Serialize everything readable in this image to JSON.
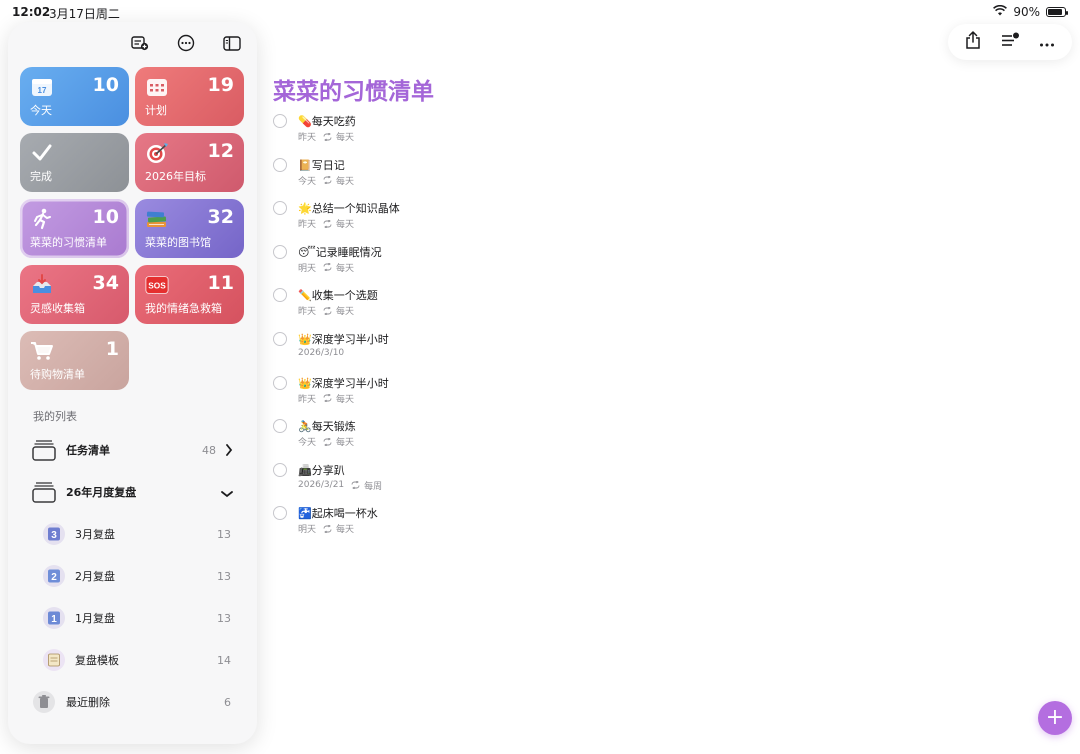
{
  "status_bar": {
    "time": "12:02",
    "date": "3月17日周二",
    "battery": "90%"
  },
  "sidebar": {
    "toolbar_icons": [
      "add-list-icon",
      "more-circle-icon",
      "sidebar-toggle-icon"
    ],
    "smart_lists": [
      {
        "label": "今天",
        "count": "10",
        "icon": "calendar-today-icon",
        "color": "#5b9ee6"
      },
      {
        "label": "计划",
        "count": "19",
        "icon": "calendar-grid-icon",
        "color": "#e06a6a"
      },
      {
        "label": "完成",
        "count": "",
        "icon": "checkmark-icon",
        "color": "#9a9ea3"
      },
      {
        "label": "2026年目标",
        "count": "12",
        "icon": "target-icon",
        "color": "#d9667a"
      },
      {
        "label": "菜菜的习惯清单",
        "count": "10",
        "icon": "running-icon",
        "color": "#b487d6"
      },
      {
        "label": "菜菜的图书馆",
        "count": "32",
        "icon": "books-icon",
        "color": "#8678d4"
      },
      {
        "label": "灵感收集箱",
        "count": "34",
        "icon": "inbox-tray-icon",
        "color": "#e06878"
      },
      {
        "label": "我的情绪急救箱",
        "count": "11",
        "icon": "sos-icon",
        "color": "#e0606e"
      },
      {
        "label": "待购物清单",
        "count": "1",
        "icon": "cart-icon",
        "color": "#d6b1ab"
      }
    ],
    "section_title": "我的列表",
    "lists": [
      {
        "label": "任务清单",
        "count": "48"
      },
      {
        "label": "26年月度复盘",
        "count": ""
      },
      {
        "label": "3月复盘",
        "count": "13",
        "badge": "3"
      },
      {
        "label": "2月复盘",
        "count": "13",
        "badge": "2"
      },
      {
        "label": "1月复盘",
        "count": "13",
        "badge": "1"
      },
      {
        "label": "复盘模板",
        "count": "14"
      },
      {
        "label": "最近删除",
        "count": "6"
      }
    ]
  },
  "main": {
    "title": "菜菜的习惯清单",
    "tasks": [
      {
        "title": "💊每天吃药",
        "date": "昨天",
        "repeat": "每天"
      },
      {
        "title": "📔写日记",
        "date": "今天",
        "repeat": "每天"
      },
      {
        "title": "🌟总结一个知识晶体",
        "date": "昨天",
        "repeat": "每天"
      },
      {
        "title": "😴记录睡眠情况",
        "date": "明天",
        "repeat": "每天"
      },
      {
        "title": "✏️收集一个选题",
        "date": "昨天",
        "repeat": "每天"
      },
      {
        "title": "👑深度学习半小时",
        "date": "2026/3/10",
        "repeat": ""
      },
      {
        "title": "👑深度学习半小时",
        "date": "昨天",
        "repeat": "每天"
      },
      {
        "title": "🚴每天锻炼",
        "date": "今天",
        "repeat": "每天"
      },
      {
        "title": "📠分享趴",
        "date": "2026/3/21",
        "repeat": "每周"
      },
      {
        "title": "🚰起床喝一杯水",
        "date": "明天",
        "repeat": "每天"
      }
    ]
  },
  "toolbar": {
    "icons": [
      "share-icon",
      "list-filter-icon",
      "ellipsis-icon"
    ]
  },
  "fab": {
    "label": "+"
  }
}
